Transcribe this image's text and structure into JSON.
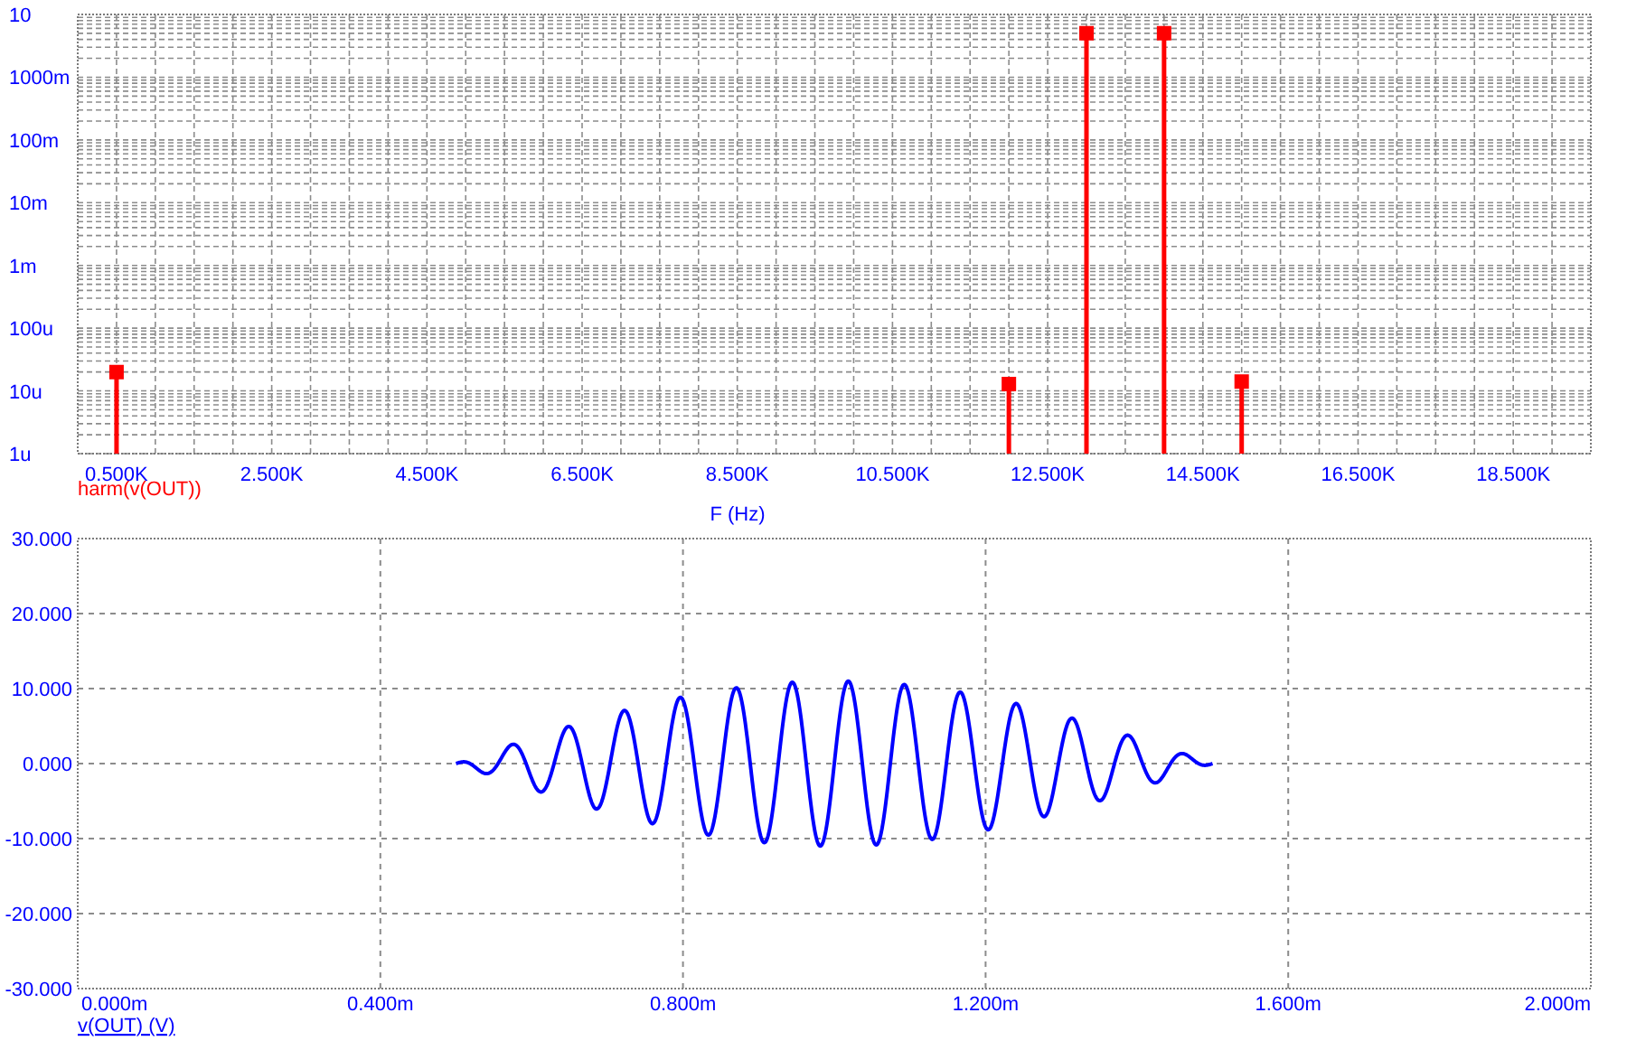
{
  "spectrum_plot": {
    "y_tick_labels": [
      "10",
      "1000m",
      "100m",
      "10m",
      "1m",
      "100u",
      "10u",
      "1u"
    ],
    "x_tick_labels": [
      "0.500K",
      "2.500K",
      "4.500K",
      "6.500K",
      "8.500K",
      "10.500K",
      "12.500K",
      "14.500K",
      "16.500K",
      "18.500K"
    ],
    "series_label": "harm(v(OUT))",
    "x_axis_title": "F (Hz)"
  },
  "waveform_plot": {
    "y_ticks": [
      "30.000",
      "20.000",
      "10.000",
      "0.000",
      "-10.000",
      "-20.000",
      "-30.000"
    ],
    "x_ticks": [
      "0.000m",
      "0.400m",
      "0.800m",
      "1.200m",
      "1.600m",
      "2.000m"
    ],
    "trace_label": "v(OUT) (V)"
  }
}
